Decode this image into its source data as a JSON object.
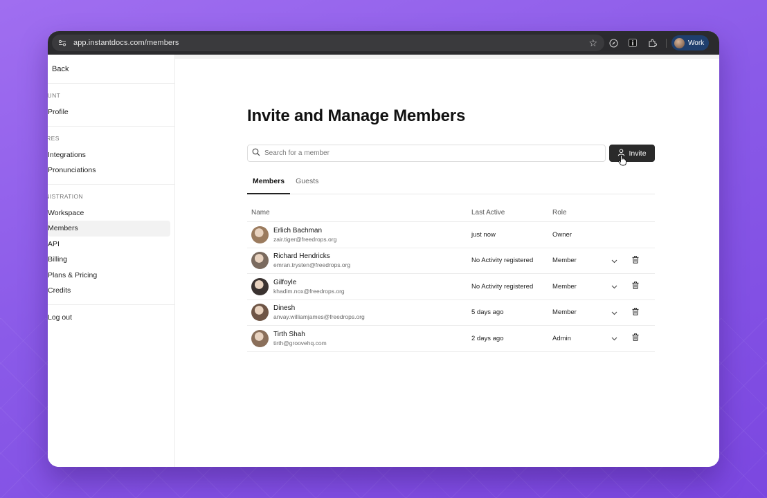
{
  "browser": {
    "url": "app.instantdocs.com/members",
    "profile_label": "Work"
  },
  "sidebar": {
    "back_label": "Back",
    "sections": [
      {
        "heading": "COUNT",
        "items": [
          "Profile"
        ]
      },
      {
        "heading": "TURES",
        "items": [
          "Integrations",
          "Pronunciations"
        ]
      },
      {
        "heading": "MINISTRATION",
        "items": [
          "Workspace",
          "Members",
          "API",
          "Billing",
          "Plans & Pricing",
          "Credits"
        ]
      }
    ],
    "active_item": "Members",
    "logout_label": "Log out"
  },
  "main": {
    "title": "Invite and Manage Members",
    "search_placeholder": "Search for a member",
    "invite_label": "Invite",
    "tabs": [
      "Members",
      "Guests"
    ],
    "active_tab": "Members",
    "columns": [
      "Name",
      "Last Active",
      "Role"
    ],
    "members": [
      {
        "name": "Erlich Bachman",
        "email": "zair.tiger@freedrops.org",
        "last_active": "just now",
        "role": "Owner",
        "editable": false,
        "avatar_color": "#9b7b5e"
      },
      {
        "name": "Richard Hendricks",
        "email": "emran.trysten@freedrops.org",
        "last_active": "No Activity registered",
        "role": "Member",
        "editable": true,
        "avatar_color": "#7a6a5e"
      },
      {
        "name": "Gilfoyle",
        "email": "khadim.nox@freedrops.org",
        "last_active": "No Activity registered",
        "role": "Member",
        "editable": true,
        "avatar_color": "#3a3230"
      },
      {
        "name": "Dinesh",
        "email": "anvay.williamjames@freedrops.org",
        "last_active": "5 days ago",
        "role": "Member",
        "editable": true,
        "avatar_color": "#6e5546"
      },
      {
        "name": "Tirth Shah",
        "email": "tirth@groovehq.com",
        "last_active": "2 days ago",
        "role": "Admin",
        "editable": true,
        "avatar_color": "#8a6f5a"
      }
    ]
  },
  "icons": {
    "search": "search-icon",
    "invite": "user-icon",
    "role_dropdown": "chevron-down-icon",
    "delete": "trash-icon"
  }
}
